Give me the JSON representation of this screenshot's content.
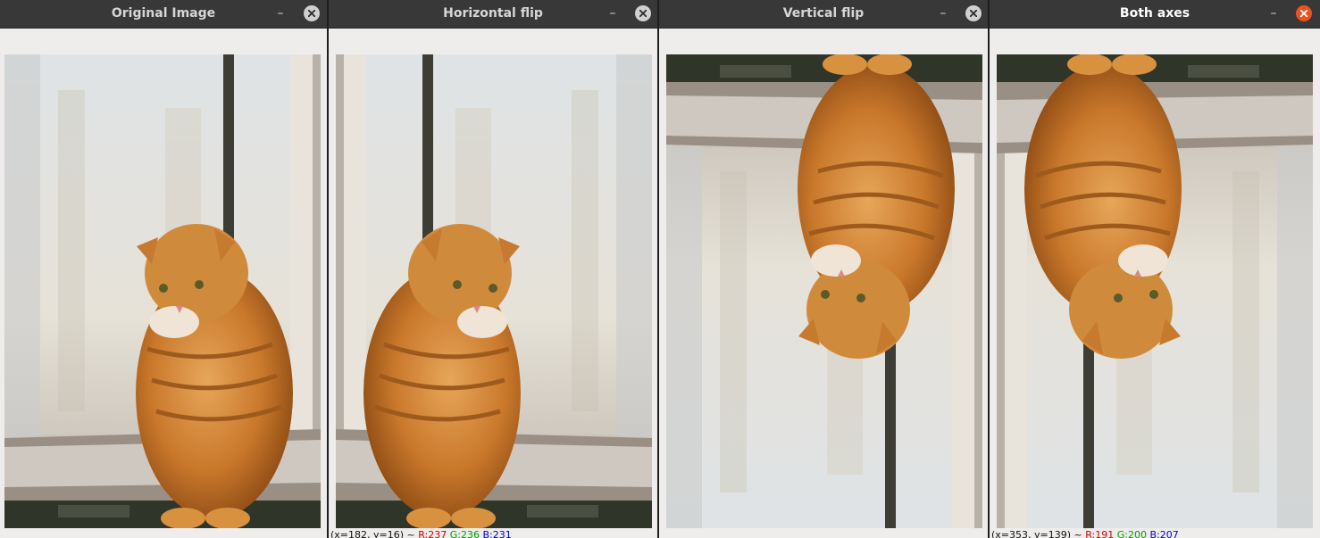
{
  "windows": [
    {
      "id": "original",
      "title": "Original Image",
      "active": false,
      "status": {
        "coords": "",
        "prefix": "",
        "r": "",
        "g": "",
        "b": ""
      }
    },
    {
      "id": "hflip",
      "title": "Horizontal flip",
      "active": false,
      "status": {
        "coords": "(x=182, y=16) ~",
        "prefix": "",
        "r": "R:237",
        "g": "G:236",
        "b": "B:231"
      }
    },
    {
      "id": "vflip",
      "title": "Vertical flip",
      "active": false,
      "status": {
        "coords": "",
        "prefix": "",
        "r": "",
        "g": "",
        "b": ""
      }
    },
    {
      "id": "both",
      "title": "Both axes",
      "active": true,
      "status": {
        "coords": "(x=353, y=139) ~",
        "prefix": "",
        "r": "R:191",
        "g": "G:200",
        "b": "B:207"
      }
    }
  ],
  "icons": {
    "minimize": "minimize-icon",
    "close": "close-icon"
  },
  "colors": {
    "titlebar": "#383838",
    "close_active": "#e95420",
    "close_inactive": "#d0d0d0",
    "window_bg": "#efedeb"
  }
}
